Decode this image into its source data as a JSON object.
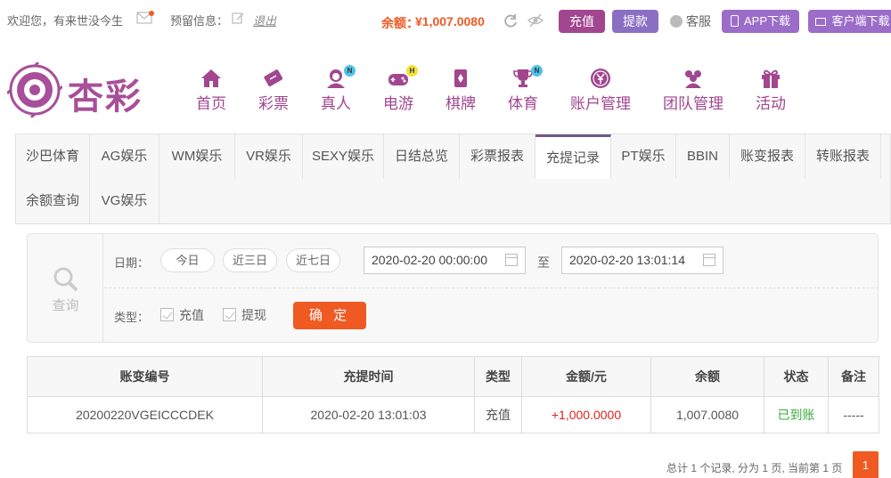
{
  "topbar": {
    "welcome": "欢迎您，有来世没今生",
    "reserved_info": "预留信息：",
    "logout": "退出",
    "balance_label": "余额：",
    "balance_value": "¥1,007.0080",
    "deposit": "充值",
    "withdraw": "提款",
    "service": "客服",
    "app_download": "APP下载",
    "client_download": "客户端下载"
  },
  "brand": {
    "name": "杏彩"
  },
  "nav": [
    {
      "label": "首页",
      "icon": "home-icon"
    },
    {
      "label": "彩票",
      "icon": "lottery-ticket-icon"
    },
    {
      "label": "真人",
      "icon": "live-dealer-icon",
      "badge": "N"
    },
    {
      "label": "电游",
      "icon": "gamepad-icon",
      "badge": "H"
    },
    {
      "label": "棋牌",
      "icon": "cards-icon"
    },
    {
      "label": "体育",
      "icon": "trophy-icon",
      "badge": "N"
    },
    {
      "label": "账户管理",
      "icon": "yen-coin-icon"
    },
    {
      "label": "团队管理",
      "icon": "team-icon"
    },
    {
      "label": "活动",
      "icon": "gift-icon"
    }
  ],
  "tabs": [
    "沙巴体育",
    "AG娱乐",
    "WM娱乐",
    "VR娱乐",
    "SEXY娱乐",
    "日结总览",
    "彩票报表",
    "充提记录",
    "PT娱乐",
    "BBIN",
    "账变报表",
    "转账报表",
    "余额查询",
    "VG娱乐"
  ],
  "active_tab": "充提记录",
  "query": {
    "search_label": "查询",
    "date_label": "日期：",
    "quick_dates": [
      "今日",
      "近三日",
      "近七日"
    ],
    "start": "2020-02-20 00:00:00",
    "to": "至",
    "end": "2020-02-20 13:01:14",
    "type_label": "类型：",
    "types": [
      "充值",
      "提现"
    ],
    "confirm": "确 定"
  },
  "table": {
    "headers": [
      "账变编号",
      "充提时间",
      "类型",
      "金额/元",
      "余额",
      "状态",
      "备注"
    ],
    "rows": [
      [
        "20200220VGEICCCDEK",
        "2020-02-20 13:01:03",
        "充值",
        "+1,000.0000",
        "1,007.0080",
        "已到账",
        "-----"
      ]
    ]
  },
  "pager": {
    "summary": "总计 1 个记录, 分为 1 页, 当前第 1 页",
    "current": "1"
  },
  "colors": {
    "brand": "#a1468f",
    "accent": "#ef5a23",
    "withdraw": "#8b6fc3",
    "success": "#3aa83a",
    "amount": "#d9261c"
  }
}
